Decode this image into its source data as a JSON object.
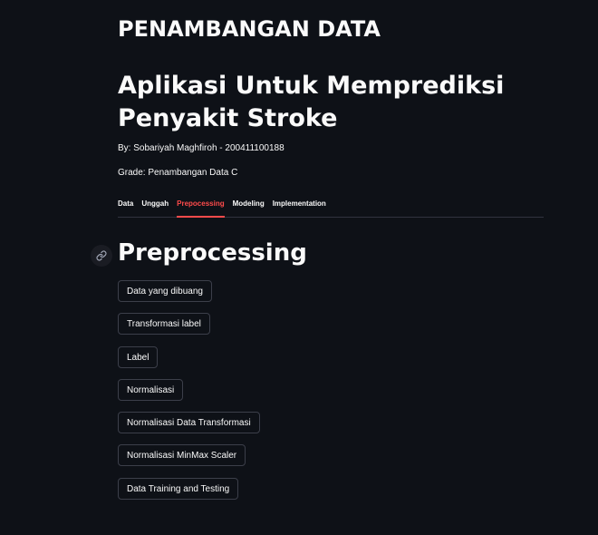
{
  "header": {
    "app_title": "PENAMBANGAN DATA",
    "subtitle": "Aplikasi Untuk Memprediksi Penyakit Stroke",
    "author": "By: Sobariyah Maghfiroh - 200411100188",
    "grade": "Grade: Penambangan Data C"
  },
  "tabs": [
    {
      "label": "Data"
    },
    {
      "label": "Unggah"
    },
    {
      "label": "Prepocessing"
    },
    {
      "label": "Modeling"
    },
    {
      "label": "Implementation"
    }
  ],
  "active_tab": "Prepocessing",
  "colors": {
    "background": "#0e1117",
    "accent": "#ff4b4b",
    "text": "#fafafa",
    "border": "#3c3f4a"
  },
  "section": {
    "title": "Preprocessing",
    "anchor_icon": "link-icon"
  },
  "buttons": [
    {
      "label": "Data yang dibuang"
    },
    {
      "label": "Transformasi label"
    },
    {
      "label": "Label"
    },
    {
      "label": "Normalisasi"
    },
    {
      "label": "Normalisasi Data Transformasi"
    },
    {
      "label": "Normalisasi MinMax Scaler"
    },
    {
      "label": "Data Training and Testing"
    }
  ]
}
